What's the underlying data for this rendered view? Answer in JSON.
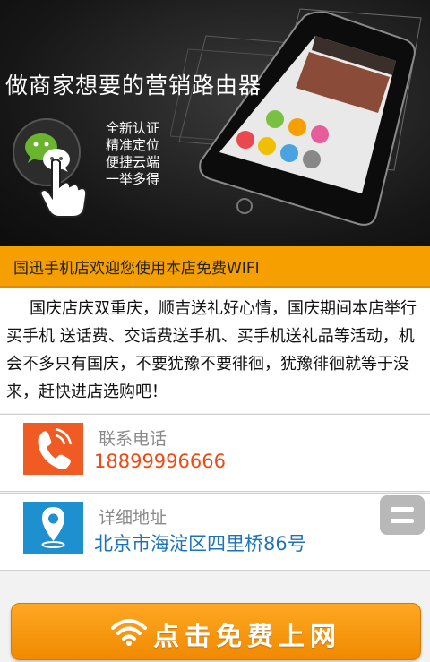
{
  "banner": {
    "title": "做商家想要的营销路由器",
    "bullets": [
      "全新认证",
      "精准定位",
      "便捷云端",
      "一举多得"
    ]
  },
  "notice": {
    "text": "国迅手机店欢迎您使用本店免费WIFI"
  },
  "description": {
    "text": "国庆店庆双重庆，顺吉送礼好心情，国庆期间本店举行买手机 送话费、交话费送手机、买手机送礼品等活动，机会不多只有国庆，不要犹豫不要徘徊，犹豫徘徊就等于没来，赶快进店选购吧！"
  },
  "contact": {
    "label": "联系电话",
    "value": "18899996666",
    "icon": "phone-icon"
  },
  "address": {
    "label": "详细地址",
    "value": "北京市海淀区四里桥86号",
    "icon": "location-pin-icon"
  },
  "menu": {
    "icon": "menu-icon"
  },
  "cta": {
    "label": "点击免费上网",
    "icon": "wifi-icon"
  },
  "colors": {
    "accent_orange": "#f5a000",
    "phone_orange": "#f05a23",
    "address_blue": "#1e8fcf",
    "phone_text": "#ee4a12",
    "address_text": "#1d73b8"
  }
}
